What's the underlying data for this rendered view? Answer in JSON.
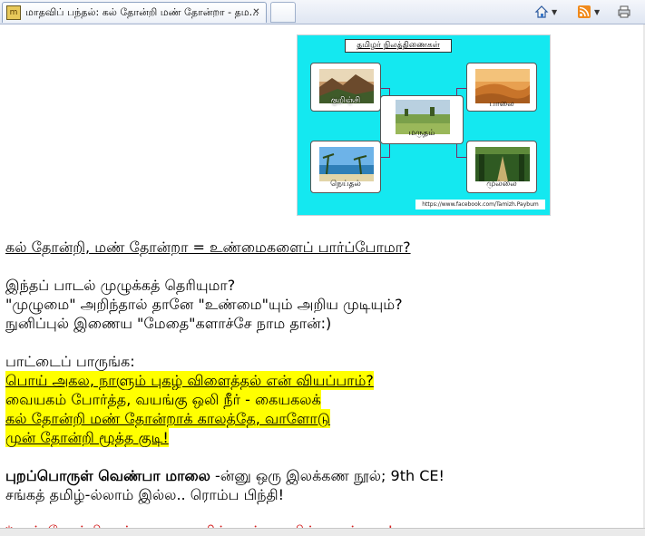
{
  "browser": {
    "tab_title": "மாதவிப் பந்தல்: கல் தோன்றி மண் தோன்றா - தம...",
    "favicon_text": "m",
    "close_glyph": "✕",
    "toolbar_icons": [
      "home-icon",
      "rss-feed-icon",
      "print-icon"
    ]
  },
  "figure": {
    "title": "தமிழர் நிலத்திணைகள்",
    "cards": [
      {
        "name": "kurinji",
        "label": "குறிஞ்சி"
      },
      {
        "name": "palai",
        "label": "பாலை"
      },
      {
        "name": "marutham",
        "label": "மருதம்"
      },
      {
        "name": "neithal",
        "label": "நெய்தல்"
      },
      {
        "name": "mullai",
        "label": "முல்லை"
      }
    ],
    "footer": "https://www.facebook.com/Tamizh.Paybum"
  },
  "post": {
    "heading": "கல் தோன்றி, மண் தோன்றா = உண்மைகளைப் பார்ப்போமா?",
    "para1": [
      "இந்தப் பாடல் முழுக்கத் தெரியுமா?",
      "\"முழுமை\" அறிந்தால் தானே \"உண்மை\"யும் அறிய முடியும்?",
      "நுனிப்புல் இணைய \"மேதை\"களாச்சே நாம தான்:)"
    ],
    "intro": "பாட்டைப் பாருங்க:",
    "verse": [
      "பொய் அகல, நாளும் புகழ் விளைத்தல் என் வியப்பாம்?",
      "வையகம் போர்த்த, வயங்கு ஒலி நீர் - கையகலக்",
      "கல் தோன்றி மண் தோன்றாக் காலத்தே, வாளோடு",
      "முன் தோன்றி மூத்த குடி!"
    ],
    "source_bold": "புறப்பொருள் வெண்பா மாலை",
    "source_rest": " -ன்னு ஒரு இலக்கண நூல்; 9th CE!",
    "note": "சங்கத் தமிழ்-ல்லாம் இல்ல.. ரொம்ப பிந்தி!",
    "partial_red": "*முன் தோன்றி மூத்த குடி = தமிழ் தான் உலகில் முதல் குடி!"
  }
}
